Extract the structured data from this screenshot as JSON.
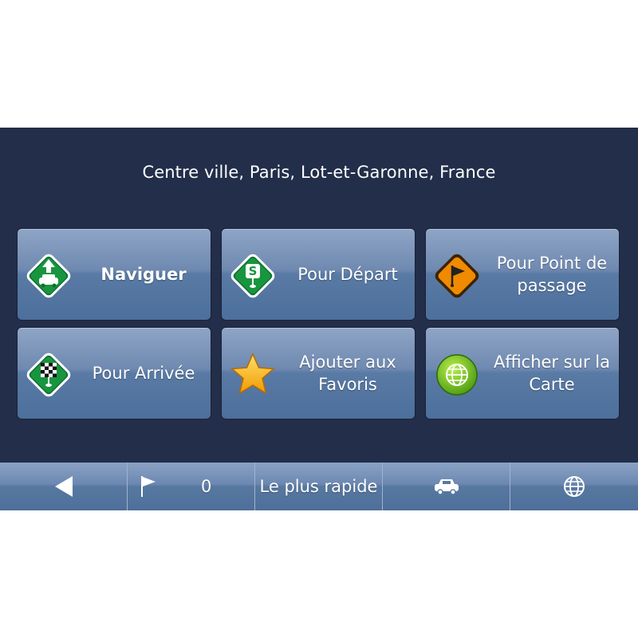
{
  "location": "Centre ville, Paris, Lot-et-Garonne, France",
  "menu": {
    "navigate": "Naviguer",
    "set_departure": "Pour Départ",
    "set_waypoint_line1": "Pour Point de",
    "set_waypoint_line2": "passage",
    "set_arrival": "Pour Arrivée",
    "add_favorites_line1": "Ajouter aux",
    "add_favorites_line2": "Favoris",
    "show_on_map_line1": "Afficher sur la",
    "show_on_map_line2": "Carte"
  },
  "bottom_bar": {
    "waypoint_count": "0",
    "route_mode": "Le plus rapide"
  },
  "icons": {
    "navigate": "navigate-car-icon",
    "departure": "start-flag-icon",
    "waypoint": "waypoint-flag-icon",
    "arrival": "finish-flag-icon",
    "favorites": "star-icon",
    "map": "globe-icon",
    "back": "back-arrow-icon",
    "flag": "flag-icon",
    "vehicle": "car-icon",
    "globe": "globe-icon"
  },
  "colors": {
    "background": "#222e4a",
    "tile": "#587aa4",
    "green_sign": "#138a3a",
    "orange_sign": "#f08a00",
    "star": "#f5b400"
  }
}
